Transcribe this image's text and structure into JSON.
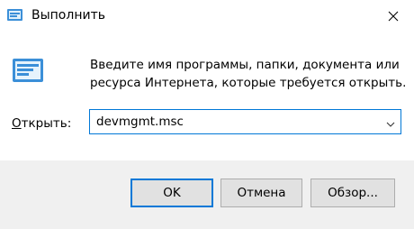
{
  "window": {
    "title": "Выполнить",
    "icon": "run-icon",
    "close_icon": "close-icon"
  },
  "main": {
    "description_line1": "Введите имя программы, папки, документа или",
    "description_line2": "ресурса Интернета, которые требуется открыть.",
    "open_label_underlined": "О",
    "open_label_rest": "ткрыть:",
    "input_value": "devmgmt.msc",
    "dropdown_icon": "chevron-down-icon"
  },
  "buttons": {
    "ok_label": "OK",
    "cancel_label": "Отмена",
    "browse_label": "Обзор..."
  },
  "colors": {
    "accent": "#0078d7",
    "footer_bg": "#f0f0f0",
    "button_bg": "#e1e1e1"
  }
}
